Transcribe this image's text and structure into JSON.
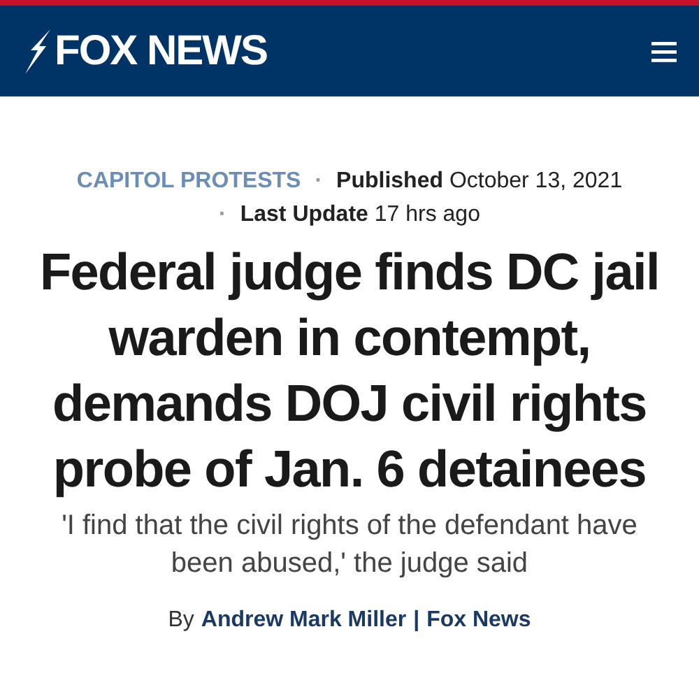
{
  "header": {
    "logo": "FOX NEWS"
  },
  "meta": {
    "category": "CAPITOL PROTESTS",
    "separator_1": "·",
    "published": "**Published** October 13, 2021",
    "separator_2": "·",
    "last_update": "**Last Update** 17 hrs ago"
  },
  "headline": "Federal judge finds DC jail warden in contempt, demands DOJ civil rights probe of Jan. 6 detainees",
  "subheadline": "'I find that the civil rights of the defendant have been abused,' the judge said",
  "byline": {
    "prefix": "By",
    "author": "Andrew Mark Miller",
    "separator": "|",
    "source": "Fox News"
  }
}
